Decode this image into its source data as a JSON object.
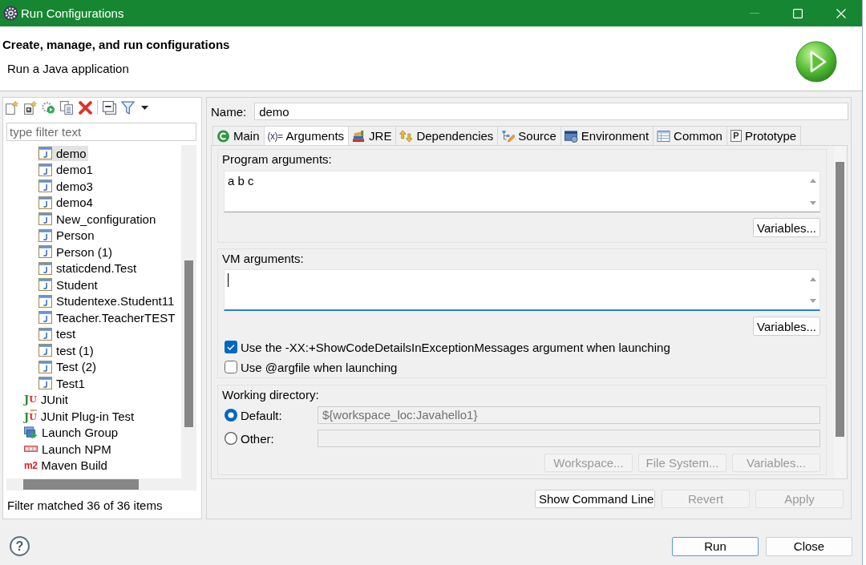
{
  "window": {
    "title": "Run Configurations",
    "controls": [
      {
        "kind": "minimize",
        "disabled": true
      },
      {
        "kind": "maximize",
        "disabled": false
      },
      {
        "kind": "close",
        "disabled": false
      }
    ]
  },
  "header": {
    "title": "Create, manage, and run configurations",
    "subtitle": "Run a Java application"
  },
  "sidebar": {
    "filter": {
      "placeholder": "type filter text"
    },
    "tree": [
      {
        "children": [
          {
            "label": "demo",
            "kind": "java",
            "selected": true
          },
          {
            "label": "demo1",
            "kind": "java",
            "selected": false
          },
          {
            "label": "demo3",
            "kind": "java",
            "selected": false
          },
          {
            "label": "demo4",
            "kind": "java",
            "selected": false
          },
          {
            "label": "New_configuration",
            "kind": "java",
            "selected": false
          },
          {
            "label": "Person",
            "kind": "java",
            "selected": false
          },
          {
            "label": "Person (1)",
            "kind": "java",
            "selected": false
          },
          {
            "label": "staticdend.Test",
            "kind": "java",
            "selected": false
          },
          {
            "label": "Student",
            "kind": "java",
            "selected": false
          },
          {
            "label": "Studentexe.Student11",
            "kind": "java",
            "selected": false
          },
          {
            "label": "Teacher.TeacherTEST",
            "kind": "java",
            "selected": false
          },
          {
            "label": "test",
            "kind": "java",
            "selected": false
          },
          {
            "label": "test (1)",
            "kind": "java",
            "selected": false
          },
          {
            "label": "Test (2)",
            "kind": "java",
            "selected": false
          },
          {
            "label": "Test1",
            "kind": "java",
            "selected": false
          }
        ]
      },
      {
        "label": "JUnit",
        "kind": "junit",
        "glyph": "JU",
        "selected": false
      },
      {
        "label": "JUnit Plug-in Test",
        "kind": "junit-plugin",
        "glyph": "JU",
        "selected": false
      },
      {
        "label": "Launch Group",
        "kind": "group",
        "selected": false
      },
      {
        "label": "Launch NPM",
        "kind": "npm",
        "selected": false
      },
      {
        "label": "Maven Build",
        "kind": "maven",
        "glyph": "m2",
        "selected": false
      }
    ],
    "status": "Filter matched 36 of 36 items"
  },
  "editor": {
    "name_label": "Name:",
    "name_value": "demo",
    "tabs": [
      {
        "label": "Main",
        "kind": "main",
        "selected": false
      },
      {
        "label": "Arguments",
        "kind": "arguments",
        "glyph": "(x)=",
        "selected": true
      },
      {
        "label": "JRE",
        "kind": "jre",
        "selected": false
      },
      {
        "label": "Dependencies",
        "kind": "dependencies",
        "selected": false
      },
      {
        "label": "Source",
        "kind": "source",
        "selected": false
      },
      {
        "label": "Environment",
        "kind": "environment",
        "selected": false
      },
      {
        "label": "Common",
        "kind": "common",
        "selected": false
      },
      {
        "label": "Prototype",
        "kind": "prototype",
        "glyph": "P",
        "selected": false
      }
    ],
    "program_arguments": {
      "label": "Program arguments:",
      "value": "a b c",
      "focused": false,
      "button": "Variables..."
    },
    "vm_arguments": {
      "label": "VM arguments:",
      "focused": true,
      "button": "Variables..."
    },
    "options": [
      {
        "label": "Use the -XX:+ShowCodeDetailsInExceptionMessages argument when launching",
        "checked": true
      },
      {
        "label": "Use @argfile when launching",
        "checked": false
      }
    ],
    "working_directory": {
      "label": "Working directory:",
      "choices": [
        {
          "label": "Default:",
          "selected": true,
          "value": "${workspace_loc:Javahello1}",
          "disabled": true
        },
        {
          "label": "Other:",
          "selected": false,
          "disabled": true
        }
      ],
      "buttons": [
        {
          "label": "Workspace...",
          "disabled": true
        },
        {
          "label": "File System...",
          "disabled": true
        },
        {
          "label": "Variables...",
          "disabled": true
        }
      ]
    },
    "actions": [
      {
        "label": "Show Command Line",
        "disabled": false
      },
      {
        "label": "Revert",
        "disabled": true
      },
      {
        "label": "Apply",
        "disabled": true
      }
    ]
  },
  "footer": {
    "help": "?",
    "buttons": [
      {
        "label": "Run",
        "default": true
      },
      {
        "label": "Close",
        "default": false
      }
    ]
  }
}
